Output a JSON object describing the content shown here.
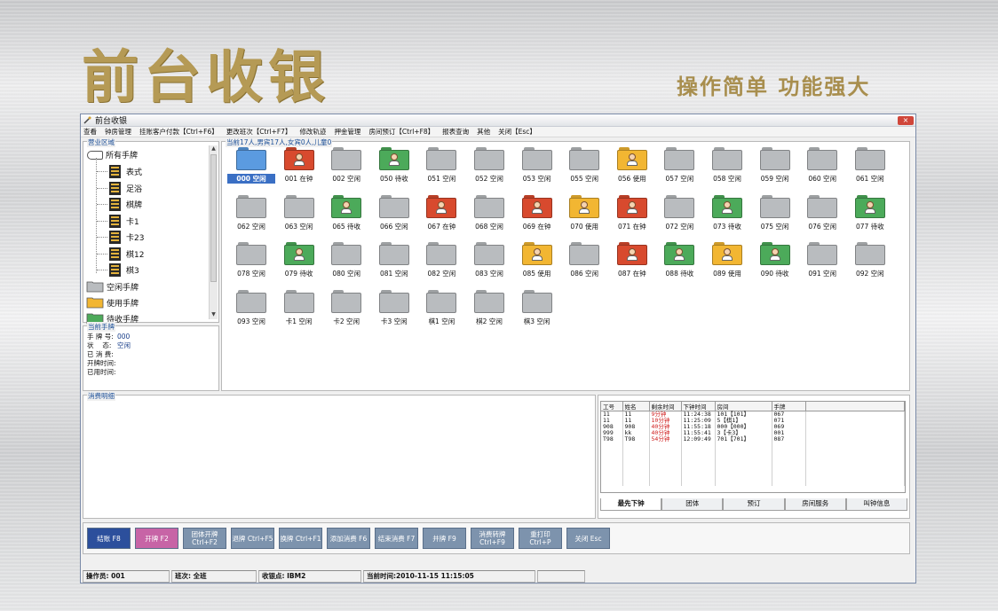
{
  "banner": {
    "title": "前台收银",
    "slogan": "操作简单 功能强大"
  },
  "window": {
    "title": "前台收银",
    "close": "×"
  },
  "menu": [
    "查看",
    "钟房管理",
    "挂账客户付款【Ctrl+F6】",
    "更改班次【Ctrl+F7】",
    "修改轨迹",
    "押金管理",
    "房间预订【Ctrl+F8】",
    "报表查询",
    "其他",
    "关闭【Esc】"
  ],
  "area": {
    "legend": "营业区域",
    "root": "所有手牌",
    "children": [
      "表式",
      "足浴",
      "棋牌",
      "卡1",
      "卡23",
      "棋12",
      "棋3"
    ],
    "legend_items": [
      {
        "label": "空闲手牌",
        "color": "#b9bcbf"
      },
      {
        "label": "使用手牌",
        "color": "#f2b632"
      },
      {
        "label": "待收手牌",
        "color": "#4caa5a"
      }
    ]
  },
  "current": {
    "legend": "当前手牌",
    "rows": [
      {
        "label": "手 牌 号:",
        "value": "000"
      },
      {
        "label": "状　 态:",
        "value": "空闲"
      },
      {
        "label": "已 消 费:",
        "value": ""
      },
      {
        "label": "开牌时间:",
        "value": ""
      },
      {
        "label": "已用时间:",
        "value": ""
      }
    ]
  },
  "grid": {
    "legend": "当前17人,男宾17人,女宾0人,儿童0",
    "colors": {
      "空闲": "#b9bcbf",
      "在钟": "#d84a2e",
      "待收": "#4caa5a",
      "使用": "#f2b632",
      "selected": "#5b9be0"
    },
    "rooms": [
      {
        "id": "000",
        "status": "空闲",
        "selected": true
      },
      {
        "id": "001",
        "status": "在钟"
      },
      {
        "id": "002",
        "status": "空闲"
      },
      {
        "id": "050",
        "status": "待收"
      },
      {
        "id": "051",
        "status": "空闲"
      },
      {
        "id": "052",
        "status": "空闲"
      },
      {
        "id": "053",
        "status": "空闲"
      },
      {
        "id": "055",
        "status": "空闲"
      },
      {
        "id": "056",
        "status": "使用"
      },
      {
        "id": "057",
        "status": "空闲"
      },
      {
        "id": "058",
        "status": "空闲"
      },
      {
        "id": "059",
        "status": "空闲"
      },
      {
        "id": "060",
        "status": "空闲"
      },
      {
        "id": "061",
        "status": "空闲"
      },
      {
        "id": "062",
        "status": "空闲"
      },
      {
        "id": "063",
        "status": "空闲"
      },
      {
        "id": "065",
        "status": "待收"
      },
      {
        "id": "066",
        "status": "空闲"
      },
      {
        "id": "067",
        "status": "在钟"
      },
      {
        "id": "068",
        "status": "空闲"
      },
      {
        "id": "069",
        "status": "在钟"
      },
      {
        "id": "070",
        "status": "使用"
      },
      {
        "id": "071",
        "status": "在钟"
      },
      {
        "id": "072",
        "status": "空闲"
      },
      {
        "id": "073",
        "status": "待收"
      },
      {
        "id": "075",
        "status": "空闲"
      },
      {
        "id": "076",
        "status": "空闲"
      },
      {
        "id": "077",
        "status": "待收"
      },
      {
        "id": "078",
        "status": "空闲"
      },
      {
        "id": "079",
        "status": "待收"
      },
      {
        "id": "080",
        "status": "空闲"
      },
      {
        "id": "081",
        "status": "空闲"
      },
      {
        "id": "082",
        "status": "空闲"
      },
      {
        "id": "083",
        "status": "空闲"
      },
      {
        "id": "085",
        "status": "使用"
      },
      {
        "id": "086",
        "status": "空闲"
      },
      {
        "id": "087",
        "status": "在钟"
      },
      {
        "id": "088",
        "status": "待收"
      },
      {
        "id": "089",
        "status": "使用"
      },
      {
        "id": "090",
        "status": "待收"
      },
      {
        "id": "091",
        "status": "空闲"
      },
      {
        "id": "092",
        "status": "空闲"
      },
      {
        "id": "093",
        "status": "空闲"
      },
      {
        "id": "卡1",
        "status": "空闲"
      },
      {
        "id": "卡2",
        "status": "空闲"
      },
      {
        "id": "卡3",
        "status": "空闲"
      },
      {
        "id": "棋1",
        "status": "空闲"
      },
      {
        "id": "棋2",
        "status": "空闲"
      },
      {
        "id": "棋3",
        "status": "空闲"
      }
    ]
  },
  "detail": {
    "legend": "消费明细"
  },
  "clock_table": {
    "headers": [
      "工号",
      "姓名",
      "剩余时间",
      "下钟时间",
      "房间",
      "手牌"
    ],
    "rows": [
      [
        "11",
        "11",
        "9分钟",
        "11:24:38",
        "101【101】",
        "067"
      ],
      [
        "11",
        "11",
        "10分钟",
        "11:25:09",
        "5【棋1】",
        "071"
      ],
      [
        "908",
        "908",
        "40分钟",
        "11:55:18",
        "000【000】",
        "069"
      ],
      [
        "999",
        "kk",
        "40分钟",
        "11:55:41",
        "3【卡3】",
        "001"
      ],
      [
        "T98",
        "T98",
        "54分钟",
        "12:09:49",
        "701【701】",
        "087"
      ]
    ],
    "tabs": [
      "最先下钟",
      "团体",
      "预订",
      "房间服务",
      "叫钟信息"
    ]
  },
  "buttons": [
    {
      "label": "结账 F8",
      "style": "blue"
    },
    {
      "label": "开牌 F2",
      "style": "pink"
    },
    {
      "label": "团体开牌\nCtrl+F2",
      "style": "gray"
    },
    {
      "label": "退牌 Ctrl+F5",
      "style": "gray"
    },
    {
      "label": "换牌 Ctrl+F1",
      "style": "gray"
    },
    {
      "label": "添加消费 F6",
      "style": "gray"
    },
    {
      "label": "结束消费 F7",
      "style": "gray"
    },
    {
      "label": "并牌 F9",
      "style": "gray"
    },
    {
      "label": "消费转牌\nCtrl+F9",
      "style": "gray"
    },
    {
      "label": "重打印\nCtrl+P",
      "style": "gray"
    },
    {
      "label": "关闭 Esc",
      "style": "gray"
    }
  ],
  "status": {
    "operator": "操作员: 001",
    "shift": "班次: 全班",
    "cashier": "收银点: IBM2",
    "time": "当前时间:2010-11-15 11:15:05"
  }
}
